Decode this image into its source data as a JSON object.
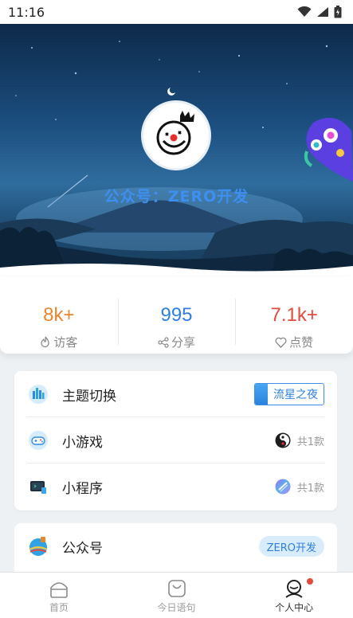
{
  "status_bar": {
    "time": "11:16",
    "icons": [
      "wifi-icon",
      "signal-icon",
      "battery-icon"
    ]
  },
  "hero": {
    "brand_title": "公众号：ZERO开发",
    "avatar_icon": "clown-king-avatar",
    "decoration_icon": "purple-monster-icon"
  },
  "stats": [
    {
      "value": "8k+",
      "label": "访客",
      "icon": "fire-icon",
      "color": "#e8862e"
    },
    {
      "value": "995",
      "label": "分享",
      "icon": "share-icon",
      "color": "#2f7fe0"
    },
    {
      "value": "7.1k+",
      "label": "点赞",
      "icon": "heart-icon",
      "color": "#e24a3c"
    }
  ],
  "menu": {
    "theme": {
      "label": "主题切换",
      "icon": "theme-city-icon",
      "button_label": "流星之夜"
    },
    "games": {
      "label": "小游戏",
      "icon": "game-icon",
      "count_text": "共1款"
    },
    "mini_programs": {
      "label": "小程序",
      "icon": "mini-program-icon",
      "count_text": "共1款"
    }
  },
  "official": {
    "label": "公众号",
    "icon": "official-account-icon",
    "pill_label": "ZERO开发"
  },
  "bottom_nav": [
    {
      "label": "首页",
      "icon": "home-icon",
      "active": false
    },
    {
      "label": "今日语句",
      "icon": "quote-bag-icon",
      "active": false
    },
    {
      "label": "个人中心",
      "icon": "profile-icon",
      "active": true
    }
  ],
  "colors": {
    "accent": "#2f7fe0",
    "orange": "#e8862e",
    "red": "#e24a3c"
  }
}
